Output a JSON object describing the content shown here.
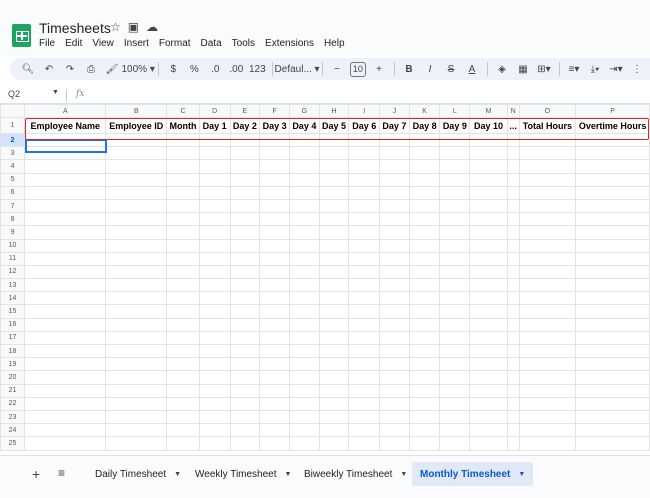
{
  "app": {
    "title": "Timesheets",
    "menu": [
      "File",
      "Edit",
      "View",
      "Insert",
      "Format",
      "Data",
      "Tools",
      "Extensions",
      "Help"
    ]
  },
  "toolbar": {
    "zoom": "100%",
    "currency": "$",
    "percent": "%",
    "dec_decrease": ".0",
    "dec_increase": ".00",
    "number_format": "123",
    "font": "Defaul...",
    "font_size": "10",
    "bold": "B",
    "italic": "I",
    "text_color": "A"
  },
  "formula_bar": {
    "name_box": "Q2",
    "fx": "fx"
  },
  "grid": {
    "columns": [
      {
        "letter": "A",
        "w": 82
      },
      {
        "letter": "B",
        "w": 61
      },
      {
        "letter": "C",
        "w": 33
      },
      {
        "letter": "D",
        "w": 31
      },
      {
        "letter": "E",
        "w": 30
      },
      {
        "letter": "F",
        "w": 30
      },
      {
        "letter": "G",
        "w": 30
      },
      {
        "letter": "H",
        "w": 30
      },
      {
        "letter": "I",
        "w": 31
      },
      {
        "letter": "J",
        "w": 30
      },
      {
        "letter": "K",
        "w": 31
      },
      {
        "letter": "L",
        "w": 30
      },
      {
        "letter": "M",
        "w": 38
      },
      {
        "letter": "N",
        "w": 12
      },
      {
        "letter": "O",
        "w": 57
      },
      {
        "letter": "P",
        "w": 74
      }
    ],
    "header_row": [
      "Employee Name",
      "Employee ID",
      "Month",
      "Day 1",
      "Day 2",
      "Day 3",
      "Day 4",
      "Day 5",
      "Day 6",
      "Day 7",
      "Day 8",
      "Day 9",
      "Day 10",
      "...",
      "Total Hours",
      "Overtime Hours"
    ],
    "row_count": 25,
    "selected_row": 2
  },
  "sheets": [
    {
      "name": "Daily Timesheet",
      "active": false
    },
    {
      "name": "Weekly Timesheet",
      "active": false
    },
    {
      "name": "Biweekly Timesheet",
      "active": false
    },
    {
      "name": "Monthly Timesheet",
      "active": true
    }
  ],
  "colors": {
    "highlight": "#e0252a",
    "accent": "#0b57d0",
    "brand": "#1ea362"
  }
}
